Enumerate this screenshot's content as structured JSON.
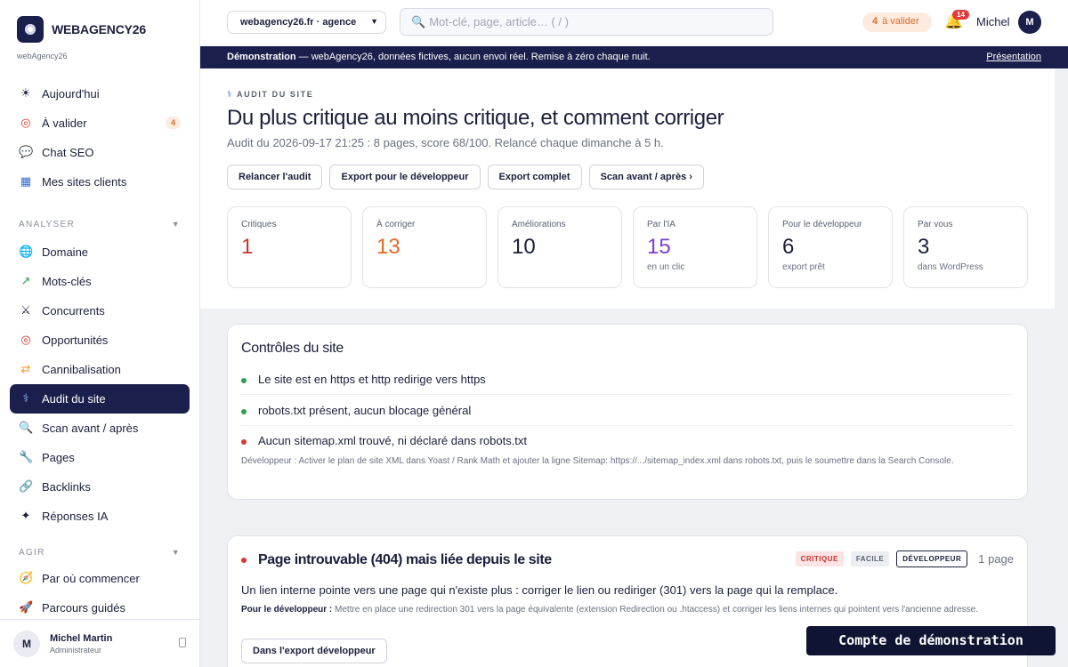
{
  "brand": {
    "name": "WEBAGENCY26",
    "sub": "webAgency26"
  },
  "sidebar": {
    "top_items": [
      {
        "icon": "☀",
        "label": "Aujourd'hui"
      },
      {
        "icon": "◎",
        "label": "À valider",
        "badge": "4"
      },
      {
        "icon": "💬",
        "label": "Chat SEO"
      },
      {
        "icon": "▦",
        "label": "Mes sites clients"
      }
    ],
    "section_analyser": "ANALYSER",
    "analyser_items": [
      {
        "icon": "🌐",
        "label": "Domaine"
      },
      {
        "icon": "↗",
        "label": "Mots-clés"
      },
      {
        "icon": "⚔",
        "label": "Concurrents"
      },
      {
        "icon": "◎",
        "label": "Opportunités"
      },
      {
        "icon": "⇄",
        "label": "Cannibalisation"
      },
      {
        "icon": "⚕",
        "label": "Audit du site",
        "active": true
      },
      {
        "icon": "🔍",
        "label": "Scan avant / après"
      },
      {
        "icon": "🔧",
        "label": "Pages"
      },
      {
        "icon": "🔗",
        "label": "Backlinks"
      },
      {
        "icon": "✦",
        "label": "Réponses IA"
      }
    ],
    "section_agir": "AGIR",
    "agir_items": [
      {
        "icon": "🧭",
        "label": "Par où commencer"
      },
      {
        "icon": "🚀",
        "label": "Parcours guidés"
      }
    ],
    "footer": {
      "avatar": "M",
      "name": "Michel Martin",
      "role": "Administrateur"
    }
  },
  "topbar": {
    "site_select": "webagency26.fr · agence",
    "search_placeholder": "Mot-clé, page, article…  ( / )",
    "valider_count": "4",
    "valider_label": "à valider",
    "notif_count": "14",
    "user_name": "Michel",
    "user_avatar": "M"
  },
  "demo_banner": {
    "bold": "Démonstration",
    "text": " — webAgency26, données fictives, aucun envoi réel. Remise à zéro chaque nuit.",
    "link": "Présentation"
  },
  "page": {
    "eyebrow": "AUDIT DU SITE",
    "title": "Du plus critique au moins critique, et comment corriger",
    "subtitle": "Audit du 2026-09-17 21:25 : 8 pages, score 68/100. Relancé chaque dimanche à 5 h.",
    "actions": [
      "Relancer l'audit",
      "Export pour le développeur",
      "Export complet",
      "Scan avant / après ›"
    ]
  },
  "stats": [
    {
      "label": "Critiques",
      "value": "1",
      "sub": "",
      "color": "#c7332d"
    },
    {
      "label": "À corriger",
      "value": "13",
      "sub": "",
      "color": "#e06a2b"
    },
    {
      "label": "Améliorations",
      "value": "10",
      "sub": "",
      "color": "#1b1f3b"
    },
    {
      "label": "Par l'IA",
      "value": "15",
      "sub": "en un clic",
      "color": "#7b3fd6"
    },
    {
      "label": "Pour le développeur",
      "value": "6",
      "sub": "export prêt",
      "color": "#1b1f3b"
    },
    {
      "label": "Par vous",
      "value": "3",
      "sub": "dans WordPress",
      "color": "#1b1f3b"
    }
  ],
  "controls": {
    "title": "Contrôles du site",
    "checks": [
      {
        "text": "Le site est en https et http redirige vers https",
        "status": "#2e9e4f"
      },
      {
        "text": "robots.txt présent, aucun blocage général",
        "status": "#2e9e4f"
      },
      {
        "text": "Aucun sitemap.xml trouvé, ni déclaré dans robots.txt",
        "status": "#d33a33"
      }
    ],
    "note": "Développeur : Activer le plan de site XML dans Yoast / Rank Math et ajouter la ligne Sitemap: https://.../sitemap_index.xml dans robots.txt, puis le soumettre dans la Search Console."
  },
  "issue": {
    "title": "Page introuvable (404) mais liée depuis le site",
    "tags": [
      "CRITIQUE",
      "FACILE",
      "DÉVELOPPEUR"
    ],
    "pages": "1 page",
    "desc": "Un lien interne pointe vers une page qui n'existe plus : corriger le lien ou rediriger (301) vers la page qui la remplace.",
    "dev_label": "Pour le développeur :",
    "dev_text": " Mettre en place une redirection 301 vers la page équivalente (extension Redirection ou .htaccess) et corriger les liens internes qui pointent vers l'ancienne adresse.",
    "button": "Dans l'export développeur"
  },
  "demo_chip": "Compte de démonstration"
}
